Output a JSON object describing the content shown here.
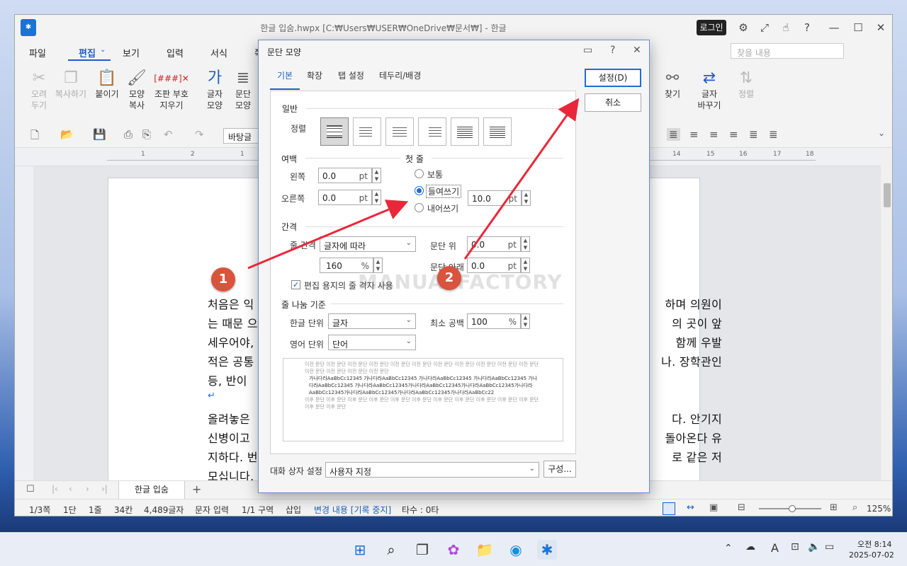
{
  "window": {
    "title": "한글 입숨.hwpx [C:₩Users₩USER₩OneDrive₩문서₩] - 한글",
    "login": "로그인",
    "find_placeholder": "찾을 내용"
  },
  "menu": [
    "파일",
    "편집",
    "보기",
    "입력",
    "서식",
    "쪽"
  ],
  "ribbon": {
    "cut": "오려\n두기",
    "copy": "복사하기",
    "paste": "붙이기",
    "format_copy": "모양\n복사",
    "clear_marks": "조판 부호\n지우기",
    "char_shape": "글자\n모양",
    "para_shape": "문단\n모양",
    "find": "찾기",
    "replace": "글자\n바꾸기",
    "sort": "정렬"
  },
  "toolbar2": {
    "style": "바탕글"
  },
  "ruler_ticks": [
    "1",
    "2",
    "1",
    "14",
    "15",
    "16",
    "17",
    "18"
  ],
  "document": {
    "lines": [
      "처음은 익",
      "는 때문 으",
      "세우어야,",
      "적은 공통",
      "등, 반이",
      "↵",
      "올려놓은",
      "신병이고",
      "지하다. 번",
      "모십니다."
    ],
    "right_lines": [
      "하며 의원이",
      "의 곳이 앞",
      "함께 우발",
      "나. 장학관인",
      "",
      "",
      "다. 안기지",
      "돌아온다 유",
      "로 같은 저",
      ""
    ]
  },
  "tabs": {
    "doc": "한글 입숨"
  },
  "status": {
    "page": "1/3쪽",
    "section": "1단",
    "line": "1줄",
    "col": "34칸",
    "chars": "4,489글자",
    "mode": "문자 입력",
    "area": "1/1 구역",
    "insert": "삽입",
    "track": "변경 내용 [기록 중지]",
    "typing": "타수 : 0타",
    "zoom": "125%"
  },
  "taskbar": {
    "time": "오전 8:14",
    "date": "2025-07-02",
    "ime": "A"
  },
  "dialog": {
    "title": "문단 모양",
    "tabs": [
      "기본",
      "확장",
      "탭 설정",
      "테두리/배경"
    ],
    "ok": "설정(D)",
    "cancel": "취소",
    "general": "일반",
    "align_label": "정렬",
    "margin": "여백",
    "left_label": "왼쪽",
    "left_value": "0.0",
    "right_label": "오른쪽",
    "right_value": "0.0",
    "unit_pt": "pt",
    "first_line": "첫 줄",
    "normal": "보통",
    "indent": "들여쓰기",
    "outdent": "내어쓰기",
    "indent_value": "10.0",
    "spacing": "간격",
    "line_spacing_label": "줄 간격",
    "line_spacing_type": "글자에 따라",
    "line_spacing_value": "160",
    "unit_pct": "%",
    "para_above_label": "문단 위",
    "para_above_value": "0.0",
    "para_below_label": "문단 아래",
    "para_below_value": "0.0",
    "grid_check": "편집 용지의 줄 격자 사용",
    "break_rule": "줄 나눔 기준",
    "hangul_unit_label": "한글 단위",
    "hangul_unit": "글자",
    "english_unit_label": "영어 단위",
    "english_unit": "단어",
    "min_space_label": "최소 공백",
    "min_space_value": "100",
    "preview_prev": "이전 문단 이전 문단 이전 문단 이전 문단 이전 문단 이전 문단 이전 문단 이전 문단 이전 문단 이전 문단 이전 문단 이전 문단 이전 문단 이전 문단 이전 문단",
    "preview_cur": "가나다라AaBbCc12345     가나다라AaBbCc12345     가나다라AaBbCc12345     가나다라AaBbCc12345   가나다라AaBbCc12345   가나다라AaBbCc12345가나다라AaBbCc12345가나다라AaBbCc12345가나다라AaBbCc12345가나다라AaBbCc12345가나다라AaBbCc12345가나다라AaBbCc22",
    "preview_next": "이후 문단 이후 문단 이후 문단 이후 문단 이후 문단 이후 문단 이후 문단 이후 문단 이후 문단 이후 문단 이후 문단 이후 문단 이후 문단",
    "dialog_setting_label": "대화 상자 설정",
    "dialog_setting_value": "사용자 지정",
    "compose": "구성..."
  },
  "annotations": {
    "badge1": "1",
    "badge2": "2",
    "watermark": "MANUALFACTORY",
    "arrow_color": "#e8283a"
  }
}
